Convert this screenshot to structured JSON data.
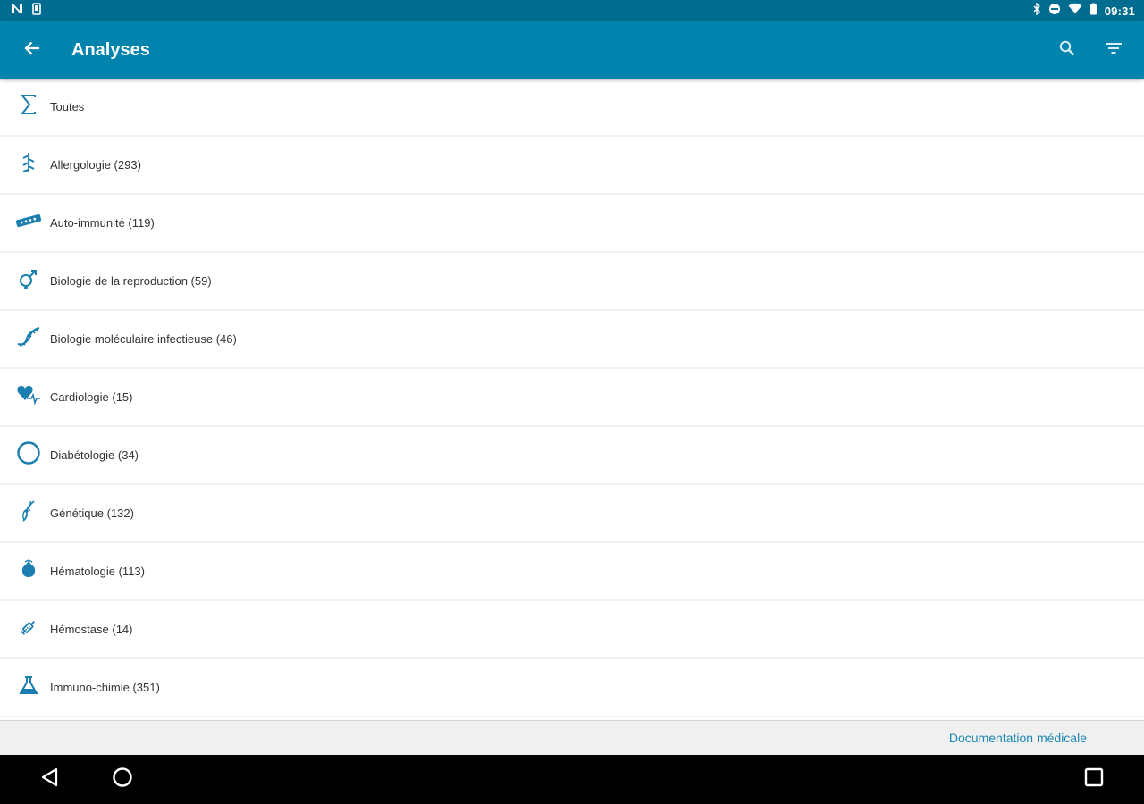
{
  "status_bar": {
    "time": "09:31",
    "left_icons": [
      "n-notification-icon",
      "phone-notification-icon"
    ],
    "right_icons": [
      "bluetooth-icon",
      "do-not-disturb-icon",
      "wifi-icon",
      "battery-icon"
    ]
  },
  "app_bar": {
    "title": "Analyses",
    "actions": [
      "search-icon",
      "filter-icon"
    ]
  },
  "list": {
    "items": [
      {
        "label": "Toutes",
        "icon": "sigma-icon"
      },
      {
        "label": "Allergologie (293)",
        "icon": "allergy-icon"
      },
      {
        "label": "Auto-immunité (119)",
        "icon": "antibody-icon"
      },
      {
        "label": "Biologie de la reproduction (59)",
        "icon": "reproduction-icon"
      },
      {
        "label": "Biologie moléculaire infectieuse (46)",
        "icon": "dna-icon"
      },
      {
        "label": "Cardiologie (15)",
        "icon": "heart-icon"
      },
      {
        "label": "Diabétologie (34)",
        "icon": "circle-icon"
      },
      {
        "label": "Génétique (132)",
        "icon": "chromosome-icon"
      },
      {
        "label": "Hématologie (113)",
        "icon": "blood-drop-icon"
      },
      {
        "label": "Hémostase (14)",
        "icon": "syringe-icon"
      },
      {
        "label": "Immuno-chimie (351)",
        "icon": "flask-icon"
      }
    ]
  },
  "footer": {
    "link": "Documentation médicale"
  },
  "nav_bar": {
    "buttons": [
      "back-triangle-icon",
      "home-circle-icon",
      "recents-square-icon"
    ]
  },
  "colors": {
    "status_bar": "#006c8f",
    "app_bar": "#0083ad",
    "icon": "#1a7fb0",
    "footer_link": "#1a87b3"
  }
}
